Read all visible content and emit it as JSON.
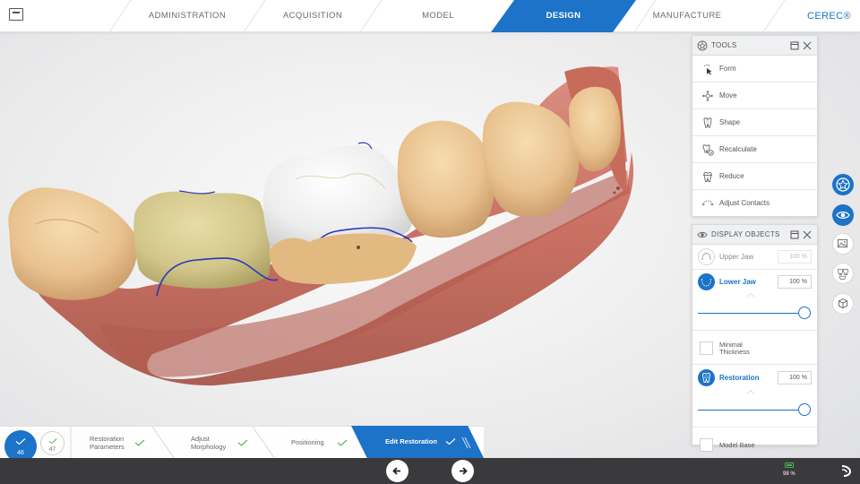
{
  "topbar": {
    "tabs": [
      {
        "label": "ADMINISTRATION"
      },
      {
        "label": "ACQUISITION"
      },
      {
        "label": "MODEL"
      },
      {
        "label": "DESIGN"
      },
      {
        "label": "MANUFACTURE"
      }
    ],
    "active_tab": "DESIGN",
    "brand": "CEREC®"
  },
  "tools_panel": {
    "title": "TOOLS",
    "items": [
      {
        "label": "Form",
        "icon": "form-cursor-icon"
      },
      {
        "label": "Move",
        "icon": "move-arrows-icon"
      },
      {
        "label": "Shape",
        "icon": "shape-tooth-icon"
      },
      {
        "label": "Recalculate",
        "icon": "recalculate-icon"
      },
      {
        "label": "Reduce",
        "icon": "reduce-tooth-icon"
      },
      {
        "label": "Adjust Contacts",
        "icon": "adjust-contacts-icon"
      }
    ]
  },
  "display_panel": {
    "title": "DISPLAY OBJECTS",
    "upper_jaw": {
      "label": "Upper Jaw",
      "value": "100 %"
    },
    "lower_jaw": {
      "label": "Lower Jaw",
      "value": "100 %",
      "slider": 1.0
    },
    "minimal_thickness": {
      "label_line1": "Minimal",
      "label_line2": "Thickness"
    },
    "restoration": {
      "label": "Restoration",
      "value": "100 %",
      "slider": 1.0
    },
    "model_base": {
      "label": "Model Base"
    }
  },
  "workflow": {
    "tooth_active": "46",
    "tooth_other": "47",
    "steps": [
      {
        "line1": "Restoration",
        "line2": "Parameters"
      },
      {
        "line1": "Adjust",
        "line2": "Morphology"
      },
      {
        "line1": "Positioning",
        "line2": ""
      },
      {
        "line1": "Edit Restoration",
        "line2": ""
      }
    ]
  },
  "footer": {
    "battery": "98 %"
  },
  "colors": {
    "accent": "#1c73c8",
    "check_green": "#5cb85c",
    "footer_bg": "#3a3a3c"
  }
}
